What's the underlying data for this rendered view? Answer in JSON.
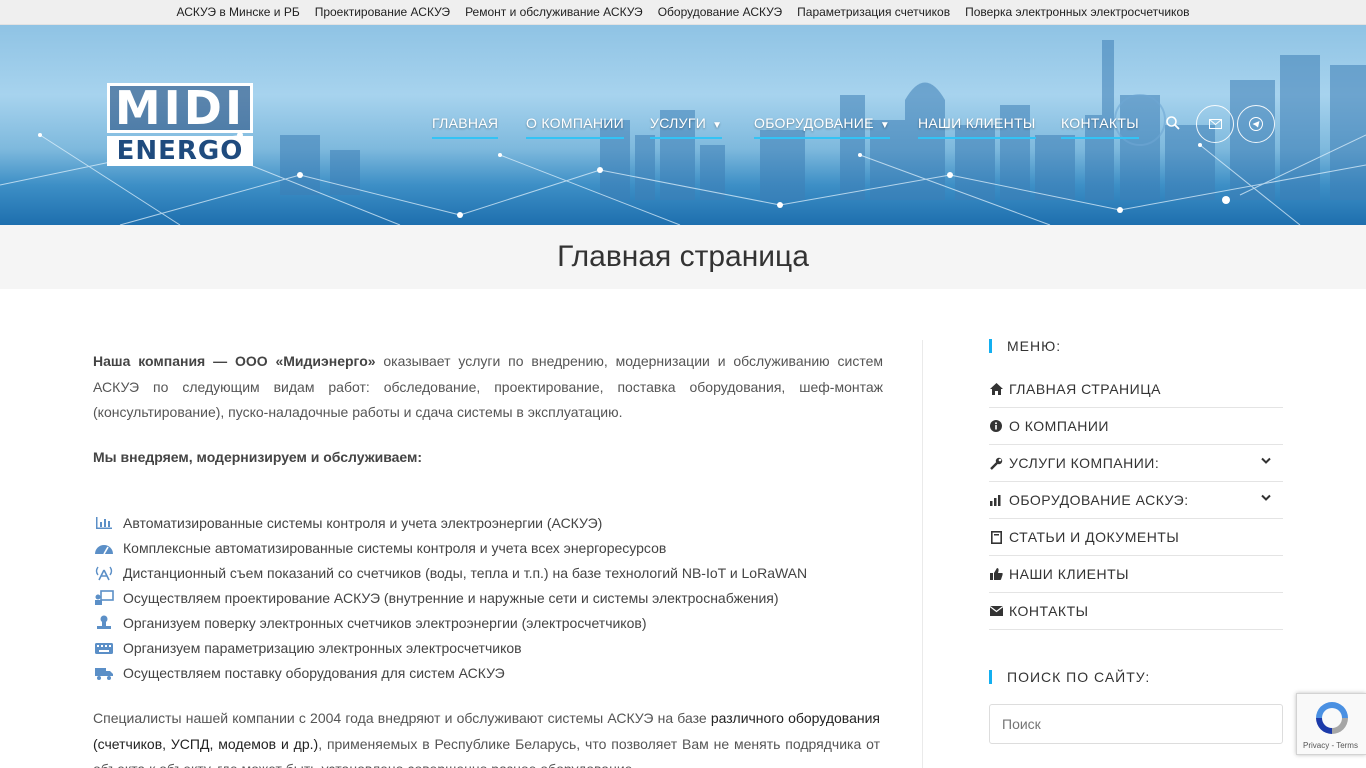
{
  "topbar": {
    "links": [
      "АСКУЭ в Минске и РБ",
      "Проектирование АСКУЭ",
      "Ремонт и обслуживание АСКУЭ",
      "Оборудование АСКУЭ",
      "Параметризация счетчиков",
      "Поверка электронных электросчетчиков"
    ]
  },
  "header": {
    "logo_top": "MIDI",
    "logo_bottom": "ENERGO",
    "nav": [
      {
        "label": "ГЛАВНАЯ"
      },
      {
        "label": "О КОМПАНИИ"
      },
      {
        "label": "УСЛУГИ"
      },
      {
        "label": "ОБОРУДОВАНИЕ"
      },
      {
        "label": "НАШИ КЛИЕНТЫ"
      },
      {
        "label": "КОНТАКТЫ"
      }
    ],
    "icons": [
      "search-icon",
      "mail-icon",
      "telegram-icon"
    ]
  },
  "page_title": "Главная страница",
  "intro": {
    "company": "Наша компания — ООО «Мидиэнерго»",
    "text": " оказывает услуги по внедрению, модернизации и обслуживанию систем АСКУЭ по следующим видам работ: обследование, проектирование, поставка оборудования, шеф-монтаж (консультирование), пуско-наладочные работы и сдача системы в эксплуатацию.",
    "subheading": "Мы внедряем, модернизируем и обслуживаем:"
  },
  "services": [
    {
      "icon": "chart-bars-icon",
      "text": "Автоматизированные системы контроля и учета электроэнергии (АСКУЭ)"
    },
    {
      "icon": "gauge-icon",
      "text": "Комплексные автоматизированные системы контроля и учета всех энергоресурсов"
    },
    {
      "icon": "antenna-icon",
      "text": "Дистанционный съем показаний со счетчиков (воды, тепла и т.п.) на базе технологий NB-IoT и LoRaWAN"
    },
    {
      "icon": "presentation-icon",
      "text": "Осуществляем проектирование АСКУЭ (внутренние и наружные сети и системы электроснабжения)"
    },
    {
      "icon": "stamp-icon",
      "text": "Организуем поверку электронных счетчиков электроэнергии (электросчетчиков)"
    },
    {
      "icon": "keyboard-icon",
      "text": "Организуем параметризацию электронных электросчетчиков"
    },
    {
      "icon": "truck-icon",
      "text": "Осуществляем поставку оборудования для систем АСКУЭ"
    }
  ],
  "para2": {
    "before": "Специалисты нашей компании с 2004 года внедряют и обслуживают системы АСКУЭ на базе ",
    "link": "различного оборудования (счетчиков, УСПД, модемов и др.)",
    "after": ", применяемых в Республике Беларусь, что позволяет Вам не менять подрядчика от объекта к объекту, где может быть установлено совершенно разное оборудование."
  },
  "sidebar": {
    "menu_heading": "МЕНЮ:",
    "menu": [
      {
        "icon": "home-icon",
        "label": "ГЛАВНАЯ СТРАНИЦА",
        "has_sub": false
      },
      {
        "icon": "info-icon",
        "label": "О КОМПАНИИ",
        "has_sub": false
      },
      {
        "icon": "wrench-icon",
        "label": "УСЛУГИ КОМПАНИИ:",
        "has_sub": true
      },
      {
        "icon": "bar-chart-icon",
        "label": "ОБОРУДОВАНИЕ АСКУЭ:",
        "has_sub": true
      },
      {
        "icon": "book-icon",
        "label": "СТАТЬИ И ДОКУМЕНТЫ",
        "has_sub": false
      },
      {
        "icon": "thumbs-up-icon",
        "label": "НАШИ КЛИЕНТЫ",
        "has_sub": false
      },
      {
        "icon": "envelope-icon",
        "label": "КОНТАКТЫ",
        "has_sub": false
      }
    ],
    "search_heading": "ПОИСК ПО САЙТУ:",
    "search_placeholder": "Поиск"
  },
  "recaptcha": {
    "links": "Privacy - Terms"
  },
  "colors": {
    "accent": "#13aff0",
    "nav_underline": "#33c3f5",
    "title_band": "#f5f5f5"
  }
}
